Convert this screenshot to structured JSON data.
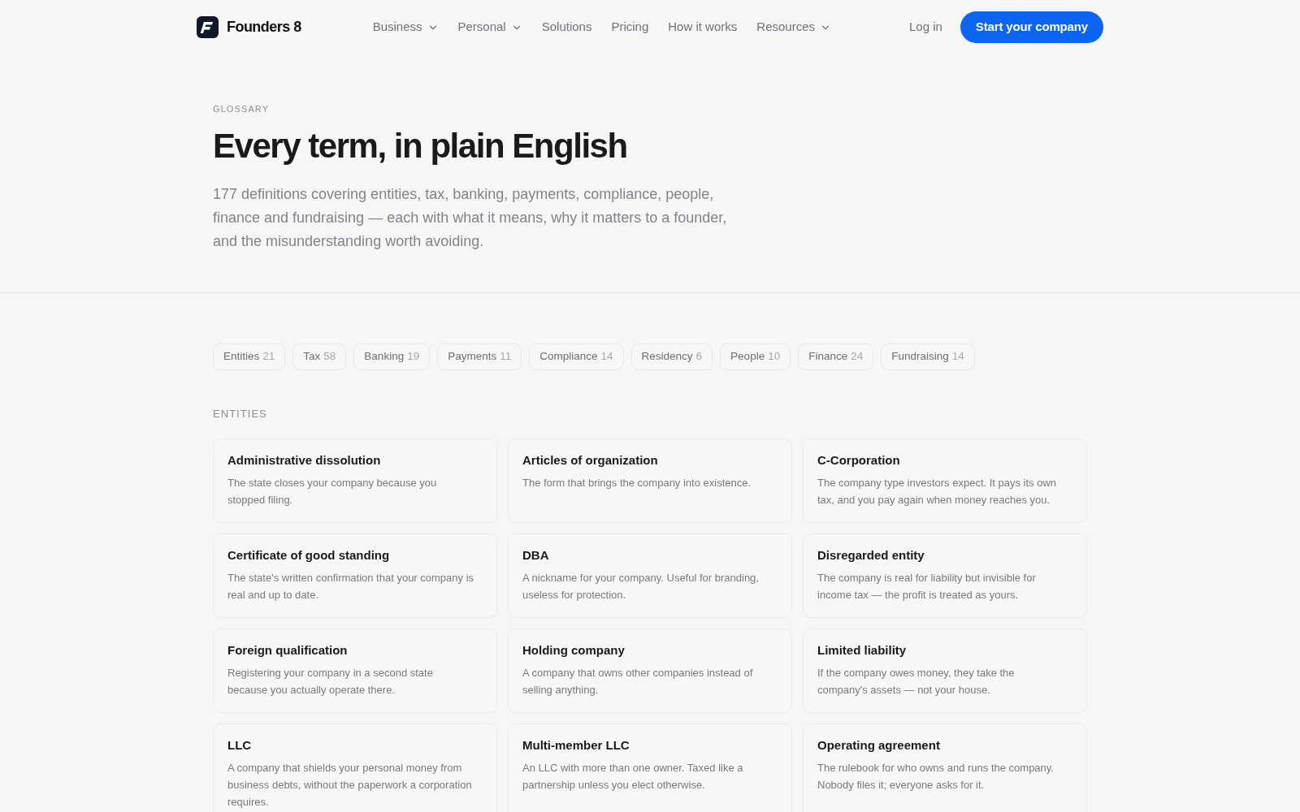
{
  "nav": {
    "brand": "Founders 8",
    "links": [
      {
        "label": "Business",
        "dropdown": true
      },
      {
        "label": "Personal",
        "dropdown": true
      },
      {
        "label": "Solutions",
        "dropdown": false
      },
      {
        "label": "Pricing",
        "dropdown": false
      },
      {
        "label": "How it works",
        "dropdown": false
      },
      {
        "label": "Resources",
        "dropdown": true
      }
    ],
    "login": "Log in",
    "cta": "Start your company"
  },
  "hero": {
    "eyebrow": "GLOSSARY",
    "title": "Every term, in plain English",
    "description": "177 definitions covering entities, tax, banking, payments, compliance, people, finance and fundraising — each with what it means, why it matters to a founder, and the misunderstanding worth avoiding."
  },
  "categories": [
    {
      "label": "Entities",
      "count": "21"
    },
    {
      "label": "Tax",
      "count": "58"
    },
    {
      "label": "Banking",
      "count": "19"
    },
    {
      "label": "Payments",
      "count": "11"
    },
    {
      "label": "Compliance",
      "count": "14"
    },
    {
      "label": "Residency",
      "count": "6"
    },
    {
      "label": "People",
      "count": "10"
    },
    {
      "label": "Finance",
      "count": "24"
    },
    {
      "label": "Fundraising",
      "count": "14"
    }
  ],
  "section": {
    "heading": "ENTITIES",
    "terms": [
      {
        "term": "Administrative dissolution",
        "definition": "The state closes your company because you stopped filing."
      },
      {
        "term": "Articles of organization",
        "definition": "The form that brings the company into existence."
      },
      {
        "term": "C-Corporation",
        "definition": "The company type investors expect. It pays its own tax, and you pay again when money reaches you."
      },
      {
        "term": "Certificate of good standing",
        "definition": "The state's written confirmation that your company is real and up to date."
      },
      {
        "term": "DBA",
        "definition": "A nickname for your company. Useful for branding, useless for protection."
      },
      {
        "term": "Disregarded entity",
        "definition": "The company is real for liability but invisible for income tax — the profit is treated as yours."
      },
      {
        "term": "Foreign qualification",
        "definition": "Registering your company in a second state because you actually operate there."
      },
      {
        "term": "Holding company",
        "definition": "A company that owns other companies instead of selling anything."
      },
      {
        "term": "Limited liability",
        "definition": "If the company owes money, they take the company's assets — not your house."
      },
      {
        "term": "LLC",
        "definition": "A company that shields your personal money from business debts, without the paperwork a corporation requires."
      },
      {
        "term": "Multi-member LLC",
        "definition": "An LLC with more than one owner. Taxed like a partnership unless you elect otherwise."
      },
      {
        "term": "Operating agreement",
        "definition": "The rulebook for who owns and runs the company. Nobody files it; everyone asks for it."
      }
    ]
  }
}
